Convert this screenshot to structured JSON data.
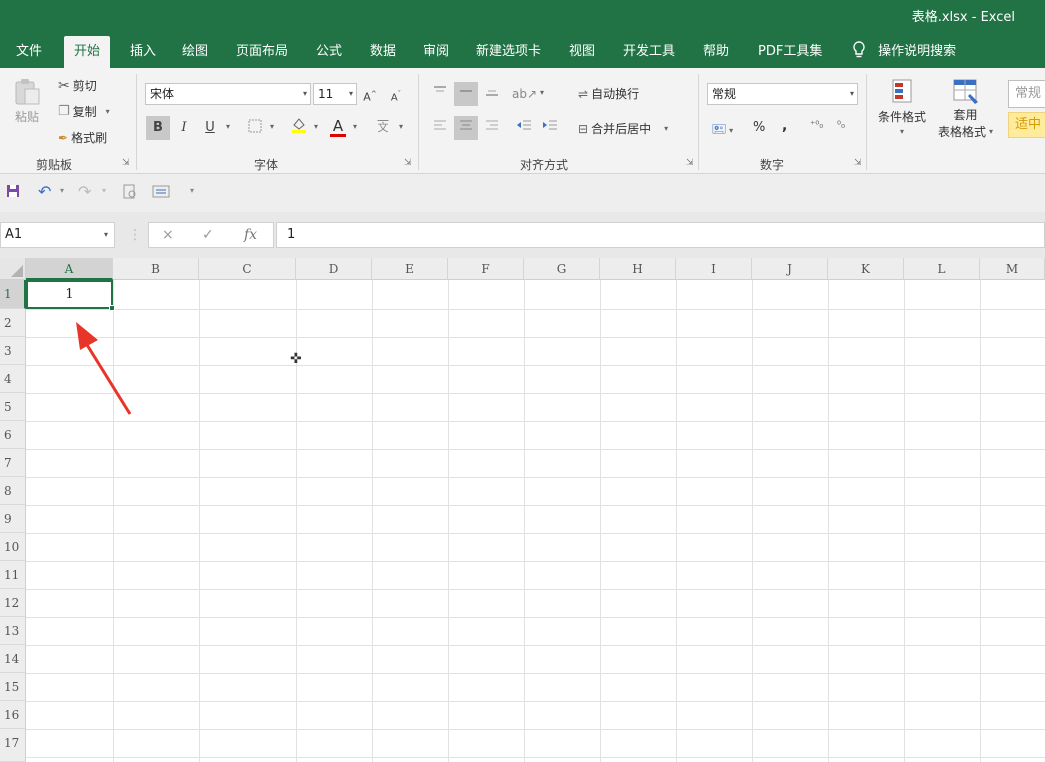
{
  "window": {
    "title": "表格.xlsx  -  Excel"
  },
  "tabs": [
    {
      "label": "文件",
      "active": false
    },
    {
      "label": "开始",
      "active": true
    },
    {
      "label": "插入",
      "active": false
    },
    {
      "label": "绘图",
      "active": false
    },
    {
      "label": "页面布局",
      "active": false
    },
    {
      "label": "公式",
      "active": false
    },
    {
      "label": "数据",
      "active": false
    },
    {
      "label": "审阅",
      "active": false
    },
    {
      "label": "新建选项卡",
      "active": false
    },
    {
      "label": "视图",
      "active": false
    },
    {
      "label": "开发工具",
      "active": false
    },
    {
      "label": "帮助",
      "active": false
    },
    {
      "label": "PDF工具集",
      "active": false
    }
  ],
  "tell_me": {
    "icon": "lightbulb-icon",
    "label": "操作说明搜索"
  },
  "ribbon": {
    "clipboard": {
      "group_label": "剪贴板",
      "paste": "粘贴",
      "cut": "剪切",
      "copy": "复制",
      "format_painter": "格式刷"
    },
    "font": {
      "group_label": "字体",
      "font_name": "宋体",
      "font_size": "11",
      "grow": "A",
      "shrink": "A",
      "bold": "B",
      "italic": "I",
      "underline": "U",
      "font_color_letter": "A",
      "phonetic": "文"
    },
    "alignment": {
      "group_label": "对齐方式",
      "wrap_text": "自动换行",
      "merge_center": "合并后居中"
    },
    "number": {
      "group_label": "数字",
      "format": "常规",
      "percent": "%",
      "comma": ","
    },
    "styles": {
      "conditional_formatting": "条件格式",
      "table_line1": "套用",
      "table_line2": "表格格式",
      "style_normal": "常规",
      "style_neutral": "适中"
    }
  },
  "formula_bar": {
    "name_box": "A1",
    "cancel": "×",
    "enter": "✓",
    "fx": "fx",
    "value": "1"
  },
  "grid": {
    "columns": [
      "A",
      "B",
      "C",
      "D",
      "E",
      "F",
      "G",
      "H",
      "I",
      "J",
      "K",
      "L",
      "M"
    ],
    "rows": [
      "1",
      "2",
      "3",
      "4",
      "5",
      "6",
      "7",
      "8",
      "9",
      "10",
      "11",
      "12",
      "13",
      "14",
      "15",
      "16",
      "17"
    ],
    "cell_A1": "1",
    "selected_column": "A",
    "selected_row": "1"
  },
  "colors": {
    "brand_green": "#217346",
    "annotation_red": "#e8352a"
  }
}
